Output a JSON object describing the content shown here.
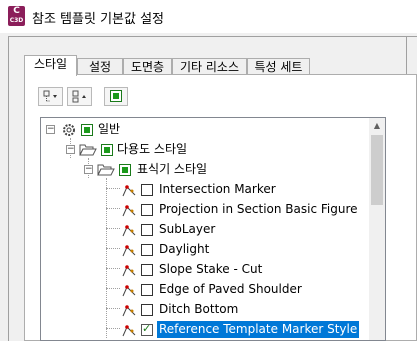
{
  "window": {
    "title": "참조 템플릿 기본값 설정",
    "app_icon_letter": "C",
    "app_icon_sub": "C3D"
  },
  "tabs": [
    {
      "label": "스타일",
      "active": true
    },
    {
      "label": "설정"
    },
    {
      "label": "도면층"
    },
    {
      "label": "기타 리소스"
    },
    {
      "label": "특성 세트"
    }
  ],
  "toolbar": [
    {
      "name": "expand-all-button",
      "icon": "expand-tree-icon"
    },
    {
      "name": "collapse-all-button",
      "icon": "collapse-tree-icon"
    },
    {
      "name": "select-all-button",
      "icon": "green-check-icon"
    }
  ],
  "tree": {
    "root": {
      "label": "일반",
      "icon": "gear-icon",
      "expander": "−"
    },
    "level1": {
      "label": "다용도 스타일",
      "icon": "folder-open-icon",
      "expander": "−"
    },
    "level2": {
      "label": "표식기 스타일",
      "icon": "folder-open-icon",
      "expander": "−"
    },
    "items": [
      {
        "label": "Intersection Marker",
        "checked": false,
        "selected": false
      },
      {
        "label": "Projection in Section Basic Figure",
        "checked": false,
        "selected": false
      },
      {
        "label": "SubLayer",
        "checked": false,
        "selected": false
      },
      {
        "label": "Daylight",
        "checked": false,
        "selected": false
      },
      {
        "label": "Slope Stake - Cut",
        "checked": false,
        "selected": false
      },
      {
        "label": "Edge of Paved Shoulder",
        "checked": false,
        "selected": false
      },
      {
        "label": "Ditch Bottom",
        "checked": false,
        "selected": false
      },
      {
        "label": "Reference Template Marker Style",
        "checked": true,
        "selected": true
      }
    ]
  }
}
